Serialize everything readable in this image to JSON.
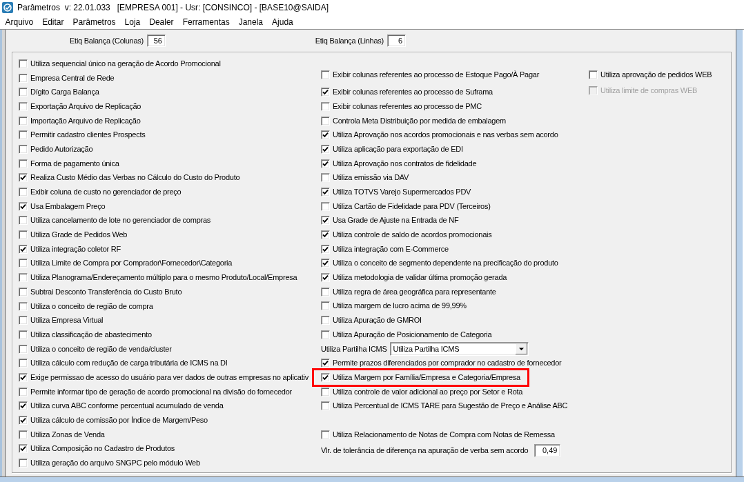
{
  "window": {
    "title": "Parâmetros  v: 22.01.033   [EMPRESA 001] - Usr: [CONSINCO] - [BASE10@SAIDA]"
  },
  "menu": [
    "Arquivo",
    "Editar",
    "Parâmetros",
    "Loja",
    "Dealer",
    "Ferramentas",
    "Janela",
    "Ajuda"
  ],
  "top_fields": [
    {
      "label": "Etiq Balança (Colunas)",
      "value": "56"
    },
    {
      "label": "Etiq Balança (Linhas)",
      "value": "6"
    }
  ],
  "options": {
    "left_column": [
      {
        "label": "Utiliza sequencial único na geração de Acordo Promocional",
        "checked": false
      },
      {
        "label": "Empresa Central de Rede",
        "checked": false
      },
      {
        "label": "Dígito Carga Balança",
        "checked": false
      },
      {
        "label": "Exportação Arquivo de Replicação",
        "checked": false
      },
      {
        "label": "Importação Arquivo de Replicação",
        "checked": false
      },
      {
        "label": "Permitir cadastro clientes Prospects",
        "checked": false
      },
      {
        "label": "Pedido Autorização",
        "checked": false
      },
      {
        "label": "Forma de pagamento única",
        "checked": false
      },
      {
        "label": "Realiza Custo Médio das Verbas no Cálculo do Custo do Produto",
        "checked": true
      },
      {
        "label": "Exibir coluna de custo no gerenciador de preço",
        "checked": false
      },
      {
        "label": "Usa Embalagem Preço",
        "checked": true
      },
      {
        "label": "Utiliza cancelamento de lote no gerenciador de compras",
        "checked": false
      },
      {
        "label": "Utiliza Grade de Pedidos Web",
        "checked": false
      },
      {
        "label": "Utiliza integração coletor RF",
        "checked": true
      },
      {
        "label": "Utiliza Limite de Compra por Comprador\\Fornecedor\\Categoria",
        "checked": false
      },
      {
        "label": "Utiliza Planograma/Endereçamento múltiplo para o mesmo Produto/Local/Empresa",
        "checked": false
      },
      {
        "label": "Subtrai Desconto Transferência do Custo Bruto",
        "checked": false
      },
      {
        "label": "Utiliza o conceito de região de compra",
        "checked": false
      },
      {
        "label": "Utiliza Empresa Virtual",
        "checked": false
      },
      {
        "label": "Utiliza classificação de abastecimento",
        "checked": false
      },
      {
        "label": "Utiliza o conceito de região de venda/cluster",
        "checked": false
      },
      {
        "label": "Utiliza cálculo com redução de carga tributária de ICMS na DI",
        "checked": false
      },
      {
        "label": "Exige permissao de acesso do usuário para ver dados de outras empresas no aplicativ",
        "checked": true
      },
      {
        "label": "Permite informar tipo de geração de acordo promocional na divisão do fornecedor",
        "checked": false
      },
      {
        "label": "Utiliza curva ABC conforme percentual acumulado de venda",
        "checked": true
      },
      {
        "label": "Utiliza cálculo de comissão por Índice de Margem/Peso",
        "checked": true
      },
      {
        "label": "Utiliza Zonas de Venda",
        "checked": false
      },
      {
        "label": "Utiliza Composição no Cadastro de Produtos",
        "checked": true
      },
      {
        "label": "Utiliza geração do arquivo SNGPC pelo módulo Web",
        "checked": false
      }
    ],
    "middle_column": [
      {
        "kind": "checkbox",
        "label": "Exibir colunas referentes ao processo de Estoque Pago/À Pagar",
        "checked": false,
        "highlighted": false
      },
      {
        "kind": "checkbox",
        "label": "Exibir colunas referentes ao processo de Suframa",
        "checked": true,
        "highlighted": false
      },
      {
        "kind": "checkbox",
        "label": "Exibir colunas referentes ao processo de PMC",
        "checked": false,
        "highlighted": false
      },
      {
        "kind": "checkbox",
        "label": "Controla Meta Distribuição por medida de embalagem",
        "checked": false,
        "highlighted": false
      },
      {
        "kind": "checkbox",
        "label": "Utiliza Aprovação nos acordos promocionais e nas verbas sem acordo",
        "checked": true,
        "highlighted": false
      },
      {
        "kind": "checkbox",
        "label": "Utiliza aplicação para exportação de EDI",
        "checked": true,
        "highlighted": false
      },
      {
        "kind": "checkbox",
        "label": "Utiliza Aprovação nos contratos de fidelidade",
        "checked": true,
        "highlighted": false
      },
      {
        "kind": "checkbox",
        "label": "Utiliza emissão via DAV",
        "checked": false,
        "highlighted": false
      },
      {
        "kind": "checkbox",
        "label": "Utiliza TOTVS Varejo Supermercados PDV",
        "checked": true,
        "highlighted": false
      },
      {
        "kind": "checkbox",
        "label": "Utiliza Cartão de Fidelidade para PDV (Terceiros)",
        "checked": false,
        "highlighted": false
      },
      {
        "kind": "checkbox",
        "label": "Usa Grade de Ajuste na Entrada de NF",
        "checked": true,
        "highlighted": false
      },
      {
        "kind": "checkbox",
        "label": "Utiliza controle de saldo de acordos promocionais",
        "checked": true,
        "highlighted": false
      },
      {
        "kind": "checkbox",
        "label": "Utiliza integração com E-Commerce",
        "checked": true,
        "highlighted": false
      },
      {
        "kind": "checkbox",
        "label": "Utiliza o conceito de segmento dependente na precificação do produto",
        "checked": true,
        "highlighted": false
      },
      {
        "kind": "checkbox",
        "label": "Utiliza metodologia de validar última promoção gerada",
        "checked": true,
        "highlighted": false
      },
      {
        "kind": "checkbox",
        "label": "Utiliza regra de área geográfica para representante",
        "checked": false,
        "highlighted": false
      },
      {
        "kind": "checkbox",
        "label": "Utiliza margem de lucro acima de 99,99%",
        "checked": false,
        "highlighted": false
      },
      {
        "kind": "checkbox",
        "label": "Utiliza Apuração de GMROI",
        "checked": false,
        "highlighted": false
      },
      {
        "kind": "checkbox",
        "label": "Utiliza Apuração de Posicionamento de Categoria",
        "checked": false,
        "highlighted": false
      },
      {
        "kind": "dropdown",
        "label": "Utiliza Partilha ICMS",
        "value": "Utiliza Partilha ICMS",
        "highlighted": false
      },
      {
        "kind": "checkbox",
        "label": "Permite prazos diferenciados por comprador no cadastro de fornecedor",
        "checked": true,
        "highlighted": false
      },
      {
        "kind": "checkbox",
        "label": "Utiliza Margem por Família/Empresa e Categoria/Empresa",
        "checked": true,
        "highlighted": true
      },
      {
        "kind": "checkbox",
        "label": "Utiliza controle de valor adicional ao preço por Setor e Rota",
        "checked": false,
        "highlighted": false
      },
      {
        "kind": "checkbox",
        "label": "Utiliza Percentual de ICMS TARE para Sugestão de Preço e Análise ABC",
        "checked": false,
        "highlighted": false
      }
    ],
    "middle_column_bottom": [
      {
        "kind": "checkbox",
        "label": "Utiliza Relacionamento de Notas de Compra com Notas de Remessa",
        "checked": false
      },
      {
        "kind": "number",
        "label": "Vlr. de tolerância de diferença na apuração de verba sem acordo",
        "value": "0,49"
      }
    ],
    "right_column": [
      {
        "label": "Utiliza aprovação de pedidos WEB",
        "checked": false,
        "disabled": false
      },
      {
        "label": "Utiliza limite de compras WEB",
        "checked": false,
        "disabled": true
      }
    ]
  }
}
